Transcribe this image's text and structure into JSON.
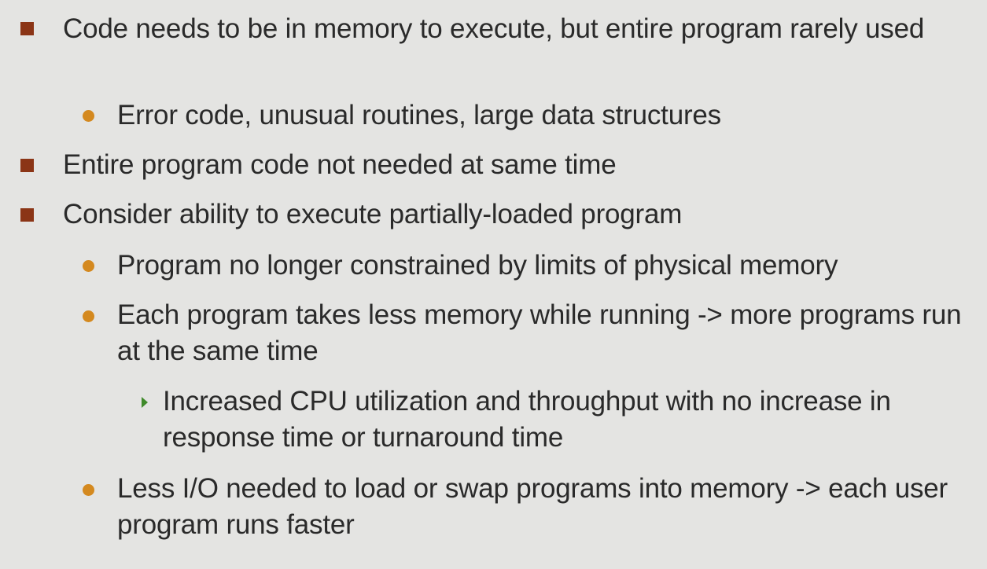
{
  "slide": {
    "bullets": [
      {
        "level": 1,
        "text": "Code needs to be in memory to execute, but entire program rarely used"
      },
      {
        "level": 2,
        "text": "Error code, unusual routines, large data structures"
      },
      {
        "level": 1,
        "text": "Entire program code not needed at same time"
      },
      {
        "level": 1,
        "text": "Consider ability to execute partially-loaded program"
      },
      {
        "level": 2,
        "text": "Program no longer constrained by limits of physical memory"
      },
      {
        "level": 2,
        "text": "Each program takes less memory while running -> more programs run at the same time"
      },
      {
        "level": 3,
        "text": "Increased CPU utilization and throughput with no increase in response time or turnaround time"
      },
      {
        "level": 2,
        "text": "Less I/O needed to load or swap programs into memory -> each user program runs faster"
      }
    ],
    "marker_colors": {
      "level1": "#8b3516",
      "level2": "#d4891f",
      "level3": "#3f8a2a"
    },
    "marker_icons": {
      "level1": "square-bullet-icon",
      "level2": "dot-bullet-icon",
      "level3": "triangle-arrow-bullet-icon"
    }
  }
}
